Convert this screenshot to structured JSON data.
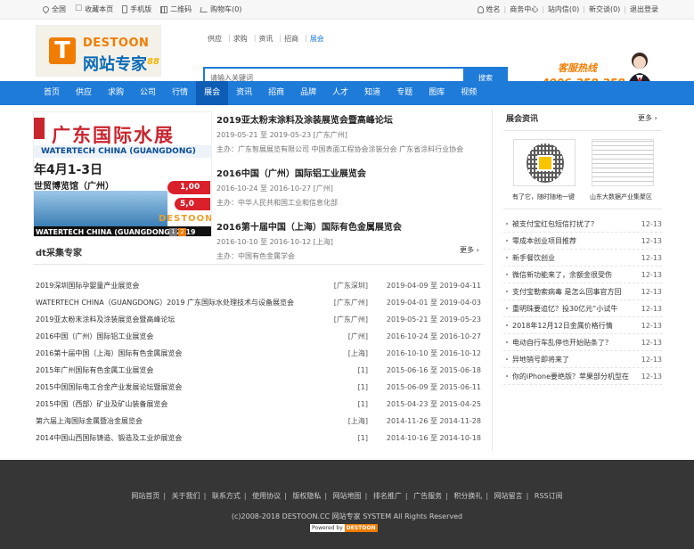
{
  "topbar": {
    "left": [
      {
        "icon": "location-pin-icon",
        "label": "全国"
      },
      {
        "icon": "star-icon",
        "label": "收藏本页"
      },
      {
        "icon": "phone-icon",
        "label": "手机版"
      },
      {
        "icon": "qrcode-icon",
        "label": "二维码"
      },
      {
        "icon": "cart-icon",
        "label": "购物车(0)"
      }
    ],
    "right": [
      "姓名",
      "商务中心",
      "站内信(0)",
      "新交谈(0)",
      "退出登录"
    ]
  },
  "logo": {
    "en": "DESTOON",
    "cn": "网站专家",
    "suffix": "88"
  },
  "search": {
    "tabs": [
      "供应",
      "求购",
      "资讯",
      "招商",
      "展会"
    ],
    "active_tab": "展会",
    "placeholder": "请输入关键词",
    "button": "搜索"
  },
  "hotline": {
    "title": "客服热线",
    "number": "4006-258-258"
  },
  "nav": {
    "items": [
      "首页",
      "供应",
      "求购",
      "公司",
      "行情",
      "展会",
      "资讯",
      "招商",
      "品牌",
      "人才",
      "知道",
      "专题",
      "图库",
      "视频"
    ],
    "active": "展会"
  },
  "banner": {
    "title": "广东国际水展",
    "strip": "WATERTECH CHINA (GUANGDONG)",
    "date": "年4月1-3日",
    "venue": "世贸博览馆（广州）",
    "badge1": "1,00",
    "badge2": "5,0",
    "brand": "DESTOON",
    "caption": "WATERTECH CHINA (GUANGDONG) 2019",
    "dots": [
      "1",
      "2"
    ]
  },
  "featured": [
    {
      "title": "2019亚太粉末涂料及涂装展览会暨高峰论坛",
      "date": "2019-05-21 至 2019-05-23 [广东广州]",
      "org": "主办：广东智展展览有限公司 中国表面工程协会涂装分会 广东省涂料行业协会"
    },
    {
      "title": "2016中国（广州）国际铝工业展览会",
      "date": "2016-10-24 至 2016-10-27 [广州]",
      "org": "主办：中华人民共和国工业和信息化部"
    },
    {
      "title": "2016第十届中国（上海）国际有色金属展览会",
      "date": "2016-10-10 至 2016-10-12 [上海]",
      "org": "主办：中国有色金属学会"
    }
  ],
  "section": {
    "title": "dt采集专家",
    "more": "更多"
  },
  "expos": [
    {
      "name": "2019深圳国际孕婴童产业展览会",
      "loc": "[广东深圳]",
      "date": "2019-04-09 至 2019-04-11"
    },
    {
      "name": "WATERTECH CHINA（GUANGDONG）2019 广东国际水处理技术与设备展览会",
      "loc": "[广东广州]",
      "date": "2019-04-01 至 2019-04-03"
    },
    {
      "name": "2019亚太粉末涂料及涂装展览会暨高峰论坛",
      "loc": "[广东广州]",
      "date": "2019-05-21 至 2019-05-23"
    },
    {
      "name": "2016中国（广州）国际铝工业展览会",
      "loc": "[广州]",
      "date": "2016-10-24 至 2016-10-27"
    },
    {
      "name": "2016第十届中国（上海）国际有色金属展览会",
      "loc": "[上海]",
      "date": "2016-10-10 至 2016-10-12"
    },
    {
      "name": "2015年广州国际有色金属工业展览会",
      "loc": "[1]",
      "date": "2015-06-16 至 2015-06-18"
    },
    {
      "name": "2015中国国际电工合金产业发展论坛暨展览会",
      "loc": "[1]",
      "date": "2015-06-09 至 2015-06-11"
    },
    {
      "name": "2015中国（西部）矿业及矿山装备展览会",
      "loc": "[1]",
      "date": "2015-04-23 至 2015-04-25"
    },
    {
      "name": "第六届上海国际金属暨冶金展览会",
      "loc": "[上海]",
      "date": "2014-11-26 至 2014-11-28"
    },
    {
      "name": "2014中国山西国际铸造、锻造及工业炉展览会",
      "loc": "[1]",
      "date": "2014-10-16 至 2014-10-18"
    }
  ],
  "right": {
    "title": "展会资讯",
    "more": "更多",
    "qr_caption": "有了它，随时随地一键",
    "doc_caption": "山东大数据产业集聚区",
    "news": [
      {
        "title": "被支付宝红包短信打扰了？",
        "date": "12-13"
      },
      {
        "title": "零成本创业项目推荐",
        "date": "12-13"
      },
      {
        "title": "新手餐饮创业",
        "date": "12-13"
      },
      {
        "title": "微信新功能来了，余额金很受伤",
        "date": "12-13"
      },
      {
        "title": "支付宝勒索病毒 是怎么回事官方回",
        "date": "12-13"
      },
      {
        "title": "重明珠要追忆？投30亿元“小试牛",
        "date": "12-13"
      },
      {
        "title": "2018年12月12日金属价格行情",
        "date": "12-13"
      },
      {
        "title": "电动自行车乱停也开始贴条了？",
        "date": "12-13"
      },
      {
        "title": "异地销号即将来了",
        "date": "12-13"
      },
      {
        "title": "你的iPhone要绝版？苹果部分机型在",
        "date": "12-13"
      }
    ]
  },
  "footer": {
    "links": [
      "网站首页",
      "关于我们",
      "联系方式",
      "使用协议",
      "版权隐私",
      "网站地图",
      "排名推广",
      "广告服务",
      "积分换礼",
      "网站留言",
      "RSS订阅"
    ],
    "copyright": "(c)2008-2018 DESTOON.CC 网站专家 SYSTEM All Rights Reserved",
    "powered_a": "Powered by",
    "powered_b": "DESTOON"
  },
  "colors": {
    "primary": "#1e7bd8",
    "nav_active": "#0d5db4",
    "accent": "#f07d00",
    "footer_bg": "#363636"
  }
}
